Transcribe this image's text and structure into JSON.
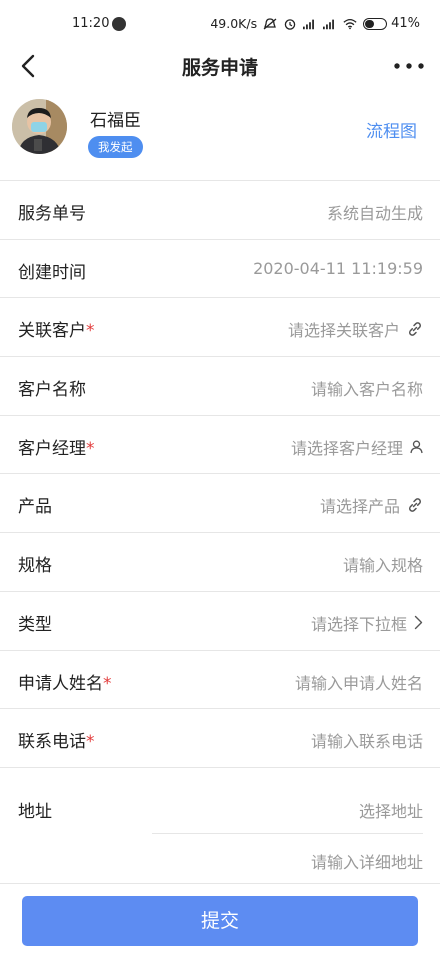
{
  "status_bar": {
    "time": "11:20",
    "speed": "49.0K/s",
    "battery": "41%",
    "battery_level": 0.41
  },
  "header": {
    "title": "服务申请",
    "back_icon": "chevron-left-icon",
    "more_icon": "more-dots-icon"
  },
  "profile": {
    "name": "石福臣",
    "badge": "我发起",
    "flow_link": "流程图"
  },
  "fields": [
    {
      "label": "服务单号",
      "required": "",
      "value": "系统自动生成",
      "icon": ""
    },
    {
      "label": "创建时间",
      "required": "",
      "value": "2020-04-11 11:19:59",
      "icon": ""
    },
    {
      "label": "关联客户",
      "required": "*",
      "value": "请选择关联客户",
      "icon": "link-icon"
    },
    {
      "label": "客户名称",
      "required": "",
      "value": "请输入客户名称",
      "icon": ""
    },
    {
      "label": "客户经理",
      "required": "*",
      "value": "请选择客户经理",
      "icon": "person-icon"
    },
    {
      "label": "产品",
      "required": "",
      "value": "请选择产品",
      "icon": "link-icon"
    },
    {
      "label": "规格",
      "required": "",
      "value": "请输入规格",
      "icon": ""
    },
    {
      "label": "类型",
      "required": "",
      "value": "请选择下拉框",
      "icon": "chevron-right-icon"
    },
    {
      "label": "申请人姓名",
      "required": "*",
      "value": "请输入申请人姓名",
      "icon": ""
    },
    {
      "label": "联系电话",
      "required": "*",
      "value": "请输入联系电话",
      "icon": ""
    }
  ],
  "address": {
    "label": "地址",
    "select_placeholder": "选择地址",
    "detail_placeholder": "请输入详细地址"
  },
  "submit_label": "提交",
  "colors": {
    "accent": "#4e8ef0",
    "submit": "#5d8cf2",
    "required": "#e23c3c"
  }
}
